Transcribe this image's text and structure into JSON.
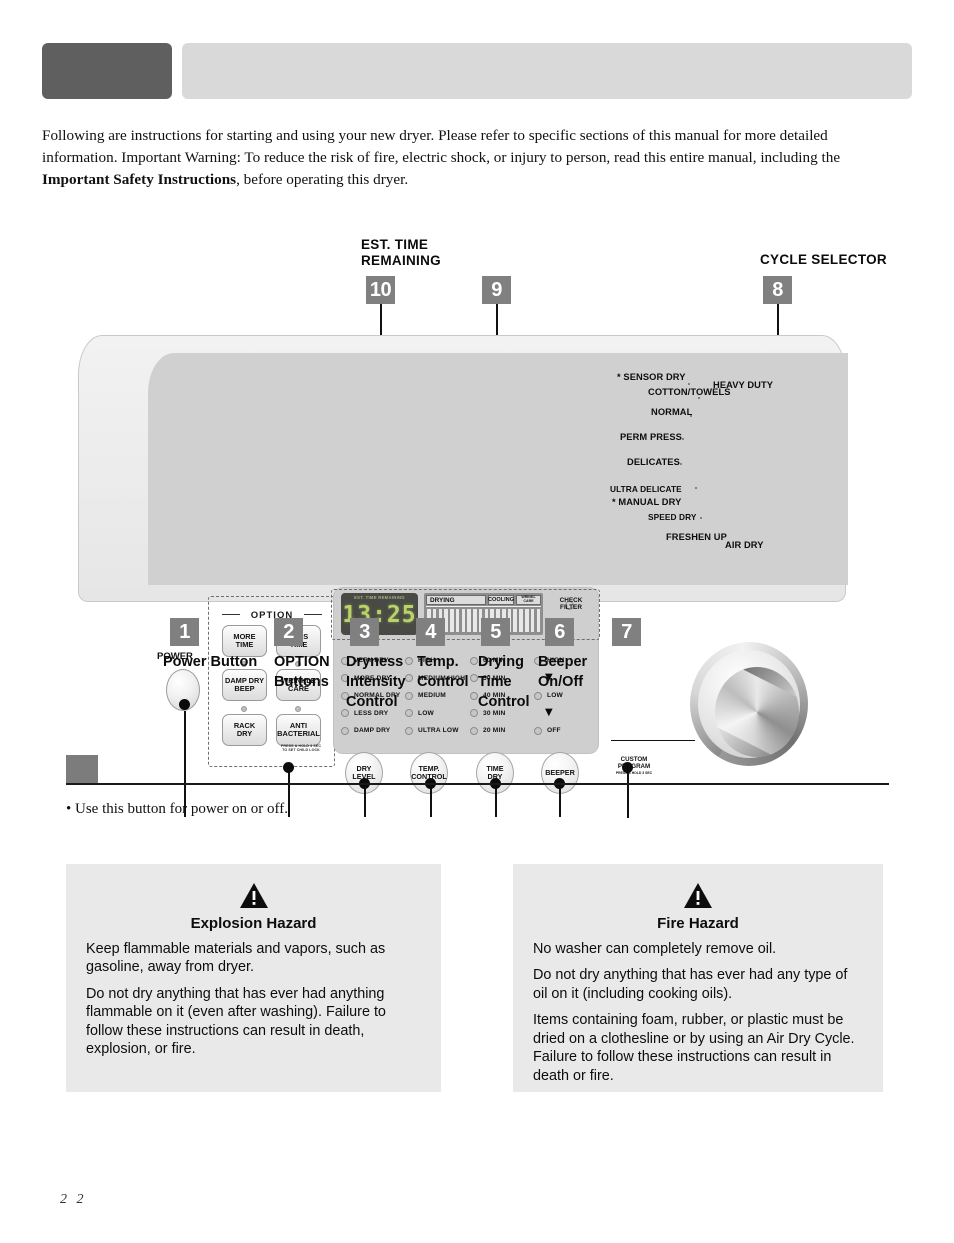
{
  "page": {
    "number": "2 2",
    "intro_part1": "Following are instructions for starting and using your new dryer.  Please refer to specific sections of this manual for more detailed information.  Important Warning:  To reduce the risk of fire, electric shock, or injury to person, read this entire manual, including the ",
    "intro_bold": "Important Safety Instructions",
    "intro_part2": ", before operating this dryer."
  },
  "header": {
    "dark_box_label": "",
    "light_box_label": ""
  },
  "section": {
    "box_label": "",
    "bullet": "• Use this button for power on or off."
  },
  "diagram": {
    "annotations": {
      "est_time_remaining": "EST. TIME\nREMAINING",
      "est_time_line1": "EST. TIME",
      "est_time_line2": "REMAINING",
      "cycle_selector": "CYCLE SELECTOR"
    },
    "callouts": [
      {
        "num": "1",
        "label_line1": "Power Button",
        "label_line2": "",
        "label_line3": ""
      },
      {
        "num": "2",
        "label_line1": "OPTION",
        "label_line2": "Buttons",
        "label_line3": ""
      },
      {
        "num": "3",
        "label_line1": "Dryness",
        "label_line2": "Intensity",
        "label_line3": "Control"
      },
      {
        "num": "4",
        "label_line1": "Temp.",
        "label_line2": "Control",
        "label_line3": ""
      },
      {
        "num": "5",
        "label_line1": "Drying",
        "label_line2": "Time",
        "label_line3": "Control"
      },
      {
        "num": "6",
        "label_line1": "Beeper",
        "label_line2": "On/Off",
        "label_line3": ""
      },
      {
        "num": "7",
        "label_line1": "",
        "label_line2": "",
        "label_line3": ""
      },
      {
        "num": "8",
        "label_line1": "",
        "label_line2": "",
        "label_line3": ""
      },
      {
        "num": "9",
        "label_line1": "",
        "label_line2": "",
        "label_line3": ""
      },
      {
        "num": "10",
        "label_line1": "",
        "label_line2": "",
        "label_line3": ""
      }
    ]
  },
  "console": {
    "power": {
      "label": "POWER"
    },
    "option": {
      "title": "OPTION",
      "buttons": [
        {
          "line1": "MORE",
          "line2": "TIME"
        },
        {
          "line1": "LESS",
          "line2": "TIME"
        },
        {
          "line1": "DAMP DRY",
          "line2": "BEEP"
        },
        {
          "line1": "WRINKLE",
          "line2": "CARE"
        },
        {
          "line1": "RACK",
          "line2": "DRY"
        },
        {
          "line1": "ANTI",
          "line2": "BACTERIAL"
        }
      ],
      "child_lock_note_line1": "PRESS & HOLD 3 SEC",
      "child_lock_note_line2": "TO SET CHILD LOCK"
    },
    "display": {
      "seg_title": "EST. TIME REMAINING",
      "seg_value": "13:25",
      "status_drying": "DRYING",
      "status_cooling": "COOLING",
      "status_wrinkle_line1": "WRINKL",
      "status_wrinkle_line2": "CARE",
      "check_filter_line1": "CHECK",
      "check_filter_line2": "FILTER"
    },
    "led_columns": [
      {
        "name": "dryness",
        "items": [
          {
            "type": "led",
            "label": "VERY DRY"
          },
          {
            "type": "led",
            "label": "MORE DRY"
          },
          {
            "type": "led",
            "label": "NORMAL DRY"
          },
          {
            "type": "led",
            "label": "LESS DRY"
          },
          {
            "type": "led",
            "label": "DAMP DRY"
          }
        ]
      },
      {
        "name": "temperature",
        "items": [
          {
            "type": "led",
            "label": "HIGH"
          },
          {
            "type": "led",
            "label": "MEDIUM HIGH"
          },
          {
            "type": "led",
            "label": "MEDIUM"
          },
          {
            "type": "led",
            "label": "LOW"
          },
          {
            "type": "led",
            "label": "ULTRA LOW"
          }
        ]
      },
      {
        "name": "time",
        "items": [
          {
            "type": "led",
            "label": "60 MIN"
          },
          {
            "type": "led",
            "label": "50 MIN"
          },
          {
            "type": "led",
            "label": "40 MIN"
          },
          {
            "type": "led",
            "label": "30 MIN"
          },
          {
            "type": "led",
            "label": "20 MIN"
          }
        ]
      },
      {
        "name": "beeper",
        "items": [
          {
            "type": "led",
            "label": "HIGH"
          },
          {
            "type": "arrow",
            "label": "▼"
          },
          {
            "type": "led",
            "label": "LOW"
          },
          {
            "type": "arrow",
            "label": "▼"
          },
          {
            "type": "led",
            "label": "OFF"
          }
        ]
      }
    ],
    "round_buttons": [
      {
        "line1": "DRY",
        "line2": "LEVEL"
      },
      {
        "line1": "TEMP.",
        "line2": "CONTROL"
      },
      {
        "line1": "TIME",
        "line2": "DRY"
      },
      {
        "line1": "BEEPER",
        "line2": ""
      }
    ],
    "cycles": [
      {
        "label": "* SENSOR DRY"
      },
      {
        "label": "COTTON/TOWELS"
      },
      {
        "label": "HEAVY DUTY"
      },
      {
        "label": "NORMAL"
      },
      {
        "label": "PERM PRESS"
      },
      {
        "label": "DELICATES"
      },
      {
        "label": "ULTRA DELICATE"
      },
      {
        "label": "* MANUAL DRY"
      },
      {
        "label": "SPEED DRY"
      },
      {
        "label": "FRESHEN UP"
      },
      {
        "label": "AIR DRY"
      }
    ],
    "custom_program": {
      "line1": "CUSTOM",
      "line2": "PROGRAM",
      "note": "PRESS & HOLD 3 SEC"
    }
  },
  "warnings": [
    {
      "id": "explosion",
      "icon": "warning-triangle-icon",
      "title": "Explosion Hazard",
      "paragraphs": [
        "Keep flammable materials and vapors, such as gasoline, away from dryer.",
        "Do not dry anything that has ever had anything flammable on it (even after washing). Failure to follow these instructions can result in death, explosion, or fire."
      ]
    },
    {
      "id": "fire",
      "icon": "warning-triangle-icon",
      "title": "Fire Hazard",
      "paragraphs": [
        "No washer can completely remove oil.",
        "Do not dry anything that has ever had any type of oil on it (including cooking oils).",
        "Items containing foam, rubber, or plastic  must be dried on a clothesline or by using an Air Dry Cycle. Failure to follow these instructions can result in death or fire."
      ]
    }
  ],
  "colors": {
    "header_dark": "#5f5f5f",
    "header_light": "#d9d9d9",
    "callout_gray": "#808080",
    "warn_bg": "#e9e9e9",
    "lcd_green": "#b9d36a",
    "lcd_bg": "#4a4a45"
  }
}
